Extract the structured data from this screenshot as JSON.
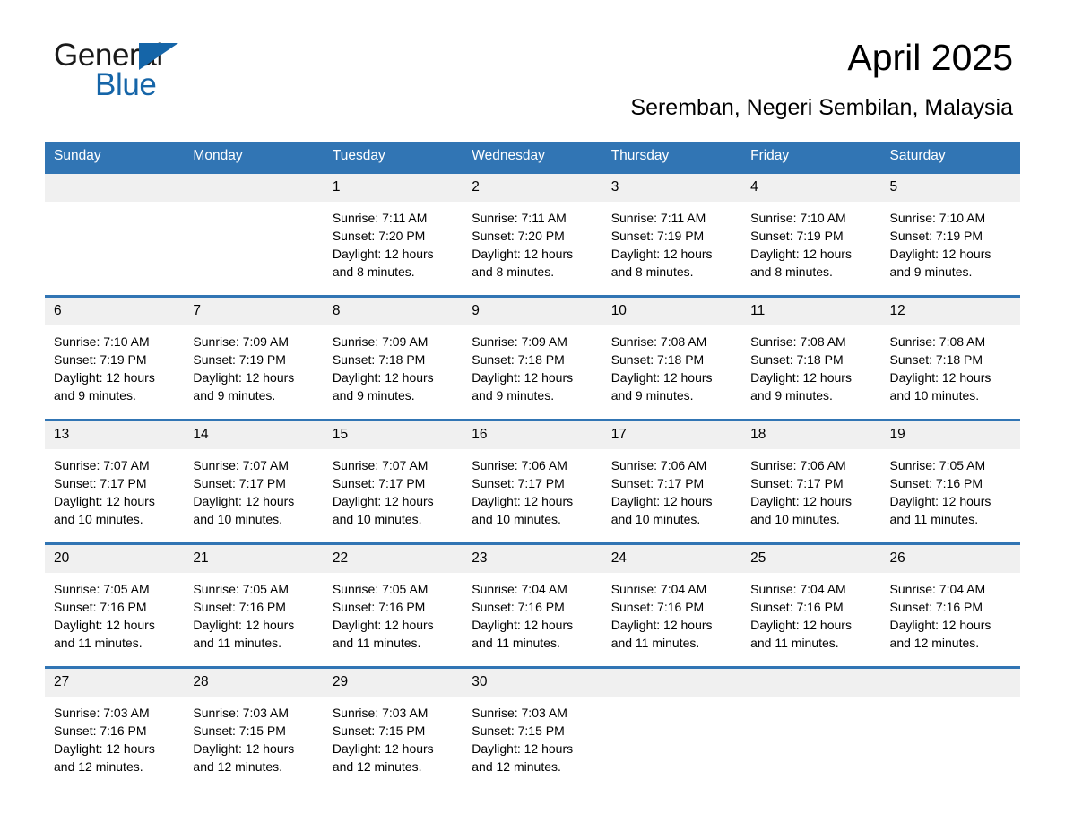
{
  "brand": {
    "name_part1": "General",
    "name_part2": "Blue",
    "triangle_color": "#1565a8"
  },
  "header": {
    "title": "April 2025",
    "location": "Seremban, Negeri Sembilan, Malaysia"
  },
  "theme": {
    "header_blue": "#3175b4",
    "row_divider_blue": "#3175b4",
    "daynum_band": "#f0f0f0",
    "page_bg": "#ffffff"
  },
  "weekday_headers": [
    "Sunday",
    "Monday",
    "Tuesday",
    "Wednesday",
    "Thursday",
    "Friday",
    "Saturday"
  ],
  "weeks": [
    [
      {
        "day": "",
        "lines": []
      },
      {
        "day": "",
        "lines": []
      },
      {
        "day": "1",
        "lines": [
          "Sunrise: 7:11 AM",
          "Sunset: 7:20 PM",
          "Daylight: 12 hours",
          "and 8 minutes."
        ]
      },
      {
        "day": "2",
        "lines": [
          "Sunrise: 7:11 AM",
          "Sunset: 7:20 PM",
          "Daylight: 12 hours",
          "and 8 minutes."
        ]
      },
      {
        "day": "3",
        "lines": [
          "Sunrise: 7:11 AM",
          "Sunset: 7:19 PM",
          "Daylight: 12 hours",
          "and 8 minutes."
        ]
      },
      {
        "day": "4",
        "lines": [
          "Sunrise: 7:10 AM",
          "Sunset: 7:19 PM",
          "Daylight: 12 hours",
          "and 8 minutes."
        ]
      },
      {
        "day": "5",
        "lines": [
          "Sunrise: 7:10 AM",
          "Sunset: 7:19 PM",
          "Daylight: 12 hours",
          "and 9 minutes."
        ]
      }
    ],
    [
      {
        "day": "6",
        "lines": [
          "Sunrise: 7:10 AM",
          "Sunset: 7:19 PM",
          "Daylight: 12 hours",
          "and 9 minutes."
        ]
      },
      {
        "day": "7",
        "lines": [
          "Sunrise: 7:09 AM",
          "Sunset: 7:19 PM",
          "Daylight: 12 hours",
          "and 9 minutes."
        ]
      },
      {
        "day": "8",
        "lines": [
          "Sunrise: 7:09 AM",
          "Sunset: 7:18 PM",
          "Daylight: 12 hours",
          "and 9 minutes."
        ]
      },
      {
        "day": "9",
        "lines": [
          "Sunrise: 7:09 AM",
          "Sunset: 7:18 PM",
          "Daylight: 12 hours",
          "and 9 minutes."
        ]
      },
      {
        "day": "10",
        "lines": [
          "Sunrise: 7:08 AM",
          "Sunset: 7:18 PM",
          "Daylight: 12 hours",
          "and 9 minutes."
        ]
      },
      {
        "day": "11",
        "lines": [
          "Sunrise: 7:08 AM",
          "Sunset: 7:18 PM",
          "Daylight: 12 hours",
          "and 9 minutes."
        ]
      },
      {
        "day": "12",
        "lines": [
          "Sunrise: 7:08 AM",
          "Sunset: 7:18 PM",
          "Daylight: 12 hours",
          "and 10 minutes."
        ]
      }
    ],
    [
      {
        "day": "13",
        "lines": [
          "Sunrise: 7:07 AM",
          "Sunset: 7:17 PM",
          "Daylight: 12 hours",
          "and 10 minutes."
        ]
      },
      {
        "day": "14",
        "lines": [
          "Sunrise: 7:07 AM",
          "Sunset: 7:17 PM",
          "Daylight: 12 hours",
          "and 10 minutes."
        ]
      },
      {
        "day": "15",
        "lines": [
          "Sunrise: 7:07 AM",
          "Sunset: 7:17 PM",
          "Daylight: 12 hours",
          "and 10 minutes."
        ]
      },
      {
        "day": "16",
        "lines": [
          "Sunrise: 7:06 AM",
          "Sunset: 7:17 PM",
          "Daylight: 12 hours",
          "and 10 minutes."
        ]
      },
      {
        "day": "17",
        "lines": [
          "Sunrise: 7:06 AM",
          "Sunset: 7:17 PM",
          "Daylight: 12 hours",
          "and 10 minutes."
        ]
      },
      {
        "day": "18",
        "lines": [
          "Sunrise: 7:06 AM",
          "Sunset: 7:17 PM",
          "Daylight: 12 hours",
          "and 10 minutes."
        ]
      },
      {
        "day": "19",
        "lines": [
          "Sunrise: 7:05 AM",
          "Sunset: 7:16 PM",
          "Daylight: 12 hours",
          "and 11 minutes."
        ]
      }
    ],
    [
      {
        "day": "20",
        "lines": [
          "Sunrise: 7:05 AM",
          "Sunset: 7:16 PM",
          "Daylight: 12 hours",
          "and 11 minutes."
        ]
      },
      {
        "day": "21",
        "lines": [
          "Sunrise: 7:05 AM",
          "Sunset: 7:16 PM",
          "Daylight: 12 hours",
          "and 11 minutes."
        ]
      },
      {
        "day": "22",
        "lines": [
          "Sunrise: 7:05 AM",
          "Sunset: 7:16 PM",
          "Daylight: 12 hours",
          "and 11 minutes."
        ]
      },
      {
        "day": "23",
        "lines": [
          "Sunrise: 7:04 AM",
          "Sunset: 7:16 PM",
          "Daylight: 12 hours",
          "and 11 minutes."
        ]
      },
      {
        "day": "24",
        "lines": [
          "Sunrise: 7:04 AM",
          "Sunset: 7:16 PM",
          "Daylight: 12 hours",
          "and 11 minutes."
        ]
      },
      {
        "day": "25",
        "lines": [
          "Sunrise: 7:04 AM",
          "Sunset: 7:16 PM",
          "Daylight: 12 hours",
          "and 11 minutes."
        ]
      },
      {
        "day": "26",
        "lines": [
          "Sunrise: 7:04 AM",
          "Sunset: 7:16 PM",
          "Daylight: 12 hours",
          "and 12 minutes."
        ]
      }
    ],
    [
      {
        "day": "27",
        "lines": [
          "Sunrise: 7:03 AM",
          "Sunset: 7:16 PM",
          "Daylight: 12 hours",
          "and 12 minutes."
        ]
      },
      {
        "day": "28",
        "lines": [
          "Sunrise: 7:03 AM",
          "Sunset: 7:15 PM",
          "Daylight: 12 hours",
          "and 12 minutes."
        ]
      },
      {
        "day": "29",
        "lines": [
          "Sunrise: 7:03 AM",
          "Sunset: 7:15 PM",
          "Daylight: 12 hours",
          "and 12 minutes."
        ]
      },
      {
        "day": "30",
        "lines": [
          "Sunrise: 7:03 AM",
          "Sunset: 7:15 PM",
          "Daylight: 12 hours",
          "and 12 minutes."
        ]
      },
      {
        "day": "",
        "lines": []
      },
      {
        "day": "",
        "lines": []
      },
      {
        "day": "",
        "lines": []
      }
    ]
  ]
}
